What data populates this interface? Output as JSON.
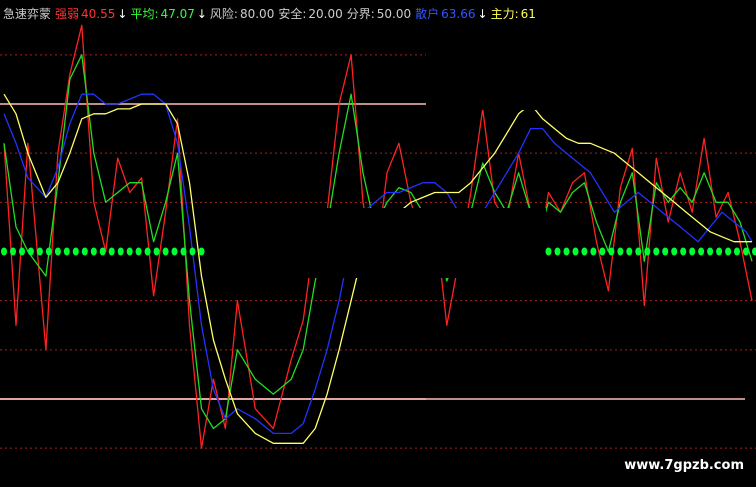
{
  "header": {
    "title": "急速弈蒙",
    "items": [
      {
        "label": "强弱",
        "value": "40.55",
        "color": "#ff3333",
        "labelColor": "#ff3333",
        "arrow": "↓",
        "arrowColor": "#ffffff"
      },
      {
        "label": "平均:",
        "value": "47.07",
        "color": "#33ff33",
        "labelColor": "#33ff33",
        "arrow": "↓",
        "arrowColor": "#ffffff"
      },
      {
        "label": "风险:",
        "value": "80.00",
        "color": "#cccccc",
        "labelColor": "#cccccc",
        "arrow": "",
        "arrowColor": ""
      },
      {
        "label": "安全:",
        "value": "20.00",
        "color": "#cccccc",
        "labelColor": "#cccccc",
        "arrow": "",
        "arrowColor": ""
      },
      {
        "label": "分界:",
        "value": "50.00",
        "color": "#cccccc",
        "labelColor": "#cccccc",
        "arrow": "",
        "arrowColor": ""
      },
      {
        "label": "散户",
        "value": "63.66",
        "color": "#3355ff",
        "labelColor": "#3355ff",
        "arrow": "↓",
        "arrowColor": "#ffffff"
      },
      {
        "label": "主力:",
        "value": "61",
        "color": "#ffff55",
        "labelColor": "#ffff55",
        "arrow": "",
        "arrowColor": ""
      }
    ]
  },
  "watermark": "www.7gpzb.com",
  "colors": {
    "background": "#000000",
    "strong": "#ff2222",
    "average": "#22dd22",
    "retail": "#2233ff",
    "main": "#ffff66",
    "level_line": "#ffbbbb",
    "grid": "#aa2222",
    "dots": "#00ff33"
  },
  "chart_data": {
    "type": "line",
    "ylim": [
      0,
      100
    ],
    "reference_lines": [
      80,
      50,
      20
    ],
    "masked_ranges": [
      [
        68,
        182
      ]
    ],
    "dot_line": {
      "y": 50,
      "ranges": [
        [
          0,
          68
        ],
        [
          182,
          251
        ]
      ],
      "step": 3
    },
    "series": [
      {
        "name": "强弱",
        "color": "#ff2222",
        "points": [
          [
            0,
            72
          ],
          [
            4,
            35
          ],
          [
            8,
            72
          ],
          [
            14,
            30
          ],
          [
            18,
            70
          ],
          [
            22,
            86
          ],
          [
            26,
            96
          ],
          [
            30,
            60
          ],
          [
            34,
            50
          ],
          [
            38,
            69
          ],
          [
            42,
            62
          ],
          [
            46,
            65
          ],
          [
            50,
            41
          ],
          [
            54,
            58
          ],
          [
            58,
            77
          ],
          [
            62,
            35
          ],
          [
            66,
            10
          ],
          [
            70,
            24
          ],
          [
            74,
            14
          ],
          [
            78,
            40
          ],
          [
            84,
            18
          ],
          [
            90,
            14
          ],
          [
            96,
            28
          ],
          [
            100,
            36
          ],
          [
            104,
            54
          ],
          [
            108,
            58
          ],
          [
            112,
            80
          ],
          [
            116,
            90
          ],
          [
            120,
            60
          ],
          [
            124,
            46
          ],
          [
            128,
            66
          ],
          [
            132,
            72
          ],
          [
            136,
            60
          ],
          [
            140,
            52
          ],
          [
            144,
            57
          ],
          [
            148,
            35
          ],
          [
            152,
            48
          ],
          [
            156,
            62
          ],
          [
            160,
            79
          ],
          [
            164,
            60
          ],
          [
            168,
            56
          ],
          [
            172,
            70
          ],
          [
            176,
            58
          ],
          [
            178,
            48
          ],
          [
            182,
            62
          ],
          [
            186,
            58
          ],
          [
            190,
            64
          ],
          [
            194,
            66
          ],
          [
            198,
            52
          ],
          [
            202,
            42
          ],
          [
            206,
            63
          ],
          [
            210,
            71
          ],
          [
            214,
            39
          ],
          [
            218,
            69
          ],
          [
            222,
            56
          ],
          [
            226,
            66
          ],
          [
            230,
            58
          ],
          [
            234,
            73
          ],
          [
            238,
            57
          ],
          [
            242,
            62
          ],
          [
            246,
            52
          ],
          [
            250,
            40
          ]
        ]
      },
      {
        "name": "平均",
        "color": "#22dd22",
        "points": [
          [
            0,
            72
          ],
          [
            4,
            55
          ],
          [
            8,
            50
          ],
          [
            14,
            45
          ],
          [
            18,
            64
          ],
          [
            22,
            85
          ],
          [
            26,
            90
          ],
          [
            30,
            70
          ],
          [
            34,
            60
          ],
          [
            38,
            62
          ],
          [
            42,
            64
          ],
          [
            46,
            64
          ],
          [
            50,
            52
          ],
          [
            54,
            60
          ],
          [
            58,
            70
          ],
          [
            62,
            40
          ],
          [
            66,
            18
          ],
          [
            70,
            14
          ],
          [
            74,
            16
          ],
          [
            78,
            30
          ],
          [
            84,
            24
          ],
          [
            90,
            21
          ],
          [
            96,
            24
          ],
          [
            100,
            30
          ],
          [
            104,
            44
          ],
          [
            108,
            55
          ],
          [
            112,
            70
          ],
          [
            116,
            82
          ],
          [
            120,
            66
          ],
          [
            124,
            55
          ],
          [
            128,
            60
          ],
          [
            132,
            63
          ],
          [
            136,
            62
          ],
          [
            140,
            58
          ],
          [
            144,
            55
          ],
          [
            148,
            44
          ],
          [
            152,
            50
          ],
          [
            156,
            58
          ],
          [
            160,
            68
          ],
          [
            164,
            62
          ],
          [
            168,
            58
          ],
          [
            172,
            66
          ],
          [
            176,
            58
          ],
          [
            178,
            52
          ],
          [
            182,
            60
          ],
          [
            186,
            58
          ],
          [
            190,
            62
          ],
          [
            194,
            64
          ],
          [
            198,
            56
          ],
          [
            202,
            50
          ],
          [
            206,
            60
          ],
          [
            210,
            66
          ],
          [
            214,
            48
          ],
          [
            218,
            64
          ],
          [
            222,
            60
          ],
          [
            226,
            63
          ],
          [
            230,
            60
          ],
          [
            234,
            66
          ],
          [
            238,
            60
          ],
          [
            242,
            60
          ],
          [
            246,
            56
          ],
          [
            250,
            48
          ]
        ]
      },
      {
        "name": "散户",
        "color": "#2233ff",
        "points": [
          [
            0,
            78
          ],
          [
            4,
            72
          ],
          [
            8,
            65
          ],
          [
            14,
            61
          ],
          [
            18,
            67
          ],
          [
            22,
            76
          ],
          [
            26,
            82
          ],
          [
            30,
            82
          ],
          [
            34,
            80
          ],
          [
            38,
            80
          ],
          [
            42,
            81
          ],
          [
            46,
            82
          ],
          [
            50,
            82
          ],
          [
            54,
            80
          ],
          [
            58,
            72
          ],
          [
            62,
            55
          ],
          [
            66,
            35
          ],
          [
            70,
            22
          ],
          [
            74,
            16
          ],
          [
            78,
            18
          ],
          [
            84,
            16
          ],
          [
            90,
            13
          ],
          [
            96,
            13
          ],
          [
            100,
            15
          ],
          [
            104,
            22
          ],
          [
            108,
            30
          ],
          [
            112,
            40
          ],
          [
            116,
            52
          ],
          [
            120,
            58
          ],
          [
            124,
            60
          ],
          [
            128,
            62
          ],
          [
            132,
            62
          ],
          [
            136,
            63
          ],
          [
            140,
            64
          ],
          [
            144,
            64
          ],
          [
            148,
            62
          ],
          [
            152,
            58
          ],
          [
            156,
            56
          ],
          [
            160,
            58
          ],
          [
            164,
            62
          ],
          [
            168,
            66
          ],
          [
            172,
            70
          ],
          [
            176,
            75
          ],
          [
            180,
            75
          ],
          [
            184,
            72
          ],
          [
            188,
            70
          ],
          [
            192,
            68
          ],
          [
            196,
            66
          ],
          [
            200,
            62
          ],
          [
            204,
            58
          ],
          [
            208,
            60
          ],
          [
            212,
            62
          ],
          [
            216,
            60
          ],
          [
            220,
            58
          ],
          [
            224,
            56
          ],
          [
            228,
            54
          ],
          [
            232,
            52
          ],
          [
            236,
            55
          ],
          [
            240,
            58
          ],
          [
            244,
            56
          ],
          [
            248,
            54
          ],
          [
            250,
            52
          ]
        ]
      },
      {
        "name": "主力",
        "color": "#ffff66",
        "points": [
          [
            0,
            82
          ],
          [
            4,
            78
          ],
          [
            8,
            70
          ],
          [
            14,
            61
          ],
          [
            18,
            64
          ],
          [
            22,
            70
          ],
          [
            26,
            77
          ],
          [
            30,
            78
          ],
          [
            34,
            78
          ],
          [
            38,
            79
          ],
          [
            42,
            79
          ],
          [
            46,
            80
          ],
          [
            50,
            80
          ],
          [
            54,
            80
          ],
          [
            58,
            76
          ],
          [
            62,
            64
          ],
          [
            66,
            45
          ],
          [
            70,
            32
          ],
          [
            74,
            24
          ],
          [
            78,
            17
          ],
          [
            84,
            13
          ],
          [
            90,
            11
          ],
          [
            96,
            11
          ],
          [
            100,
            11
          ],
          [
            104,
            14
          ],
          [
            108,
            21
          ],
          [
            112,
            30
          ],
          [
            116,
            40
          ],
          [
            120,
            50
          ],
          [
            124,
            55
          ],
          [
            128,
            57
          ],
          [
            132,
            58
          ],
          [
            136,
            60
          ],
          [
            140,
            61
          ],
          [
            144,
            62
          ],
          [
            148,
            62
          ],
          [
            152,
            62
          ],
          [
            156,
            64
          ],
          [
            160,
            67
          ],
          [
            164,
            70
          ],
          [
            168,
            74
          ],
          [
            172,
            78
          ],
          [
            176,
            80
          ],
          [
            180,
            77
          ],
          [
            184,
            75
          ],
          [
            188,
            73
          ],
          [
            192,
            72
          ],
          [
            196,
            72
          ],
          [
            200,
            71
          ],
          [
            204,
            70
          ],
          [
            208,
            68
          ],
          [
            212,
            66
          ],
          [
            216,
            64
          ],
          [
            220,
            62
          ],
          [
            224,
            60
          ],
          [
            228,
            58
          ],
          [
            232,
            56
          ],
          [
            236,
            54
          ],
          [
            240,
            53
          ],
          [
            244,
            52
          ],
          [
            248,
            52
          ],
          [
            250,
            52
          ]
        ]
      }
    ]
  }
}
